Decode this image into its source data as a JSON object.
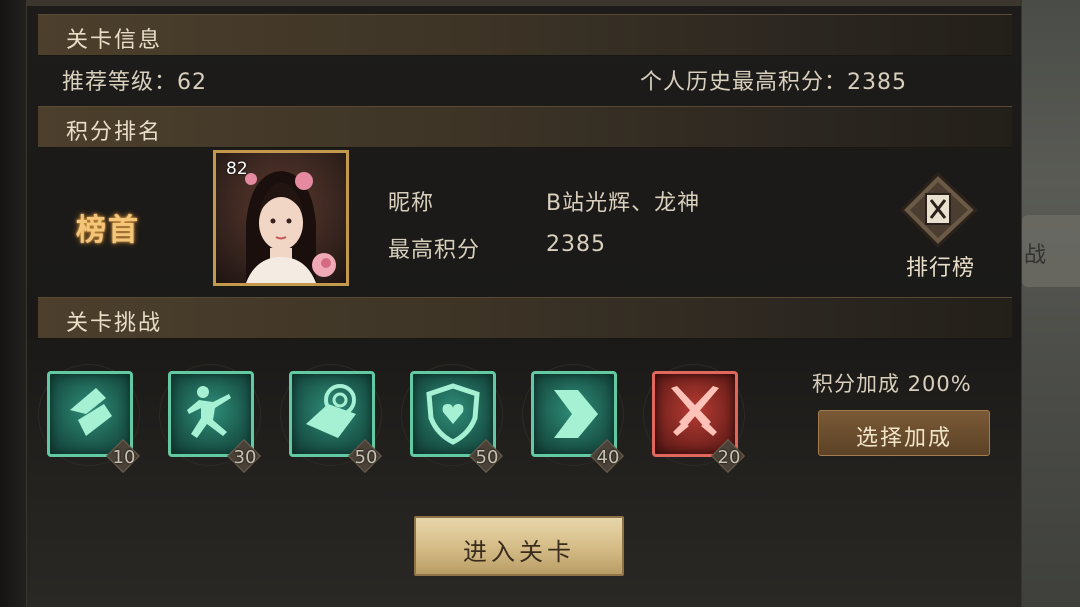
{
  "background_map": {
    "tab_text": "战"
  },
  "sections": {
    "stage_info": "关卡信息",
    "score_ranking": "积分排名",
    "stage_challenge": "关卡挑战"
  },
  "stage_info": {
    "recommended_level": "推荐等级：62",
    "personal_best": "个人历史最高积分：2385"
  },
  "ranking": {
    "rank_label": "榜首",
    "portrait_level": "82",
    "nickname_label": "昵称",
    "nickname_value": "B站光辉、龙神",
    "best_score_label": "最高积分",
    "best_score_value": "2385",
    "leaderboard_button": "排行榜"
  },
  "challenges": {
    "skills": [
      {
        "icon": "broken-blade-icon",
        "cost": "10",
        "color": "#63c9a3"
      },
      {
        "icon": "running-figure-icon",
        "cost": "30",
        "color": "#63c9a3"
      },
      {
        "icon": "swirl-wave-icon",
        "cost": "50",
        "color": "#63c9a3"
      },
      {
        "icon": "heart-shield-icon",
        "cost": "50",
        "color": "#63c9a3"
      },
      {
        "icon": "chevron-right-icon",
        "cost": "40",
        "color": "#63c9a3"
      },
      {
        "icon": "crossed-swords-icon",
        "cost": "20",
        "color": "#e0675b"
      }
    ],
    "score_bonus": "积分加成 200%",
    "select_bonus_button": "选择加成"
  },
  "enter_button": "进入关卡"
}
